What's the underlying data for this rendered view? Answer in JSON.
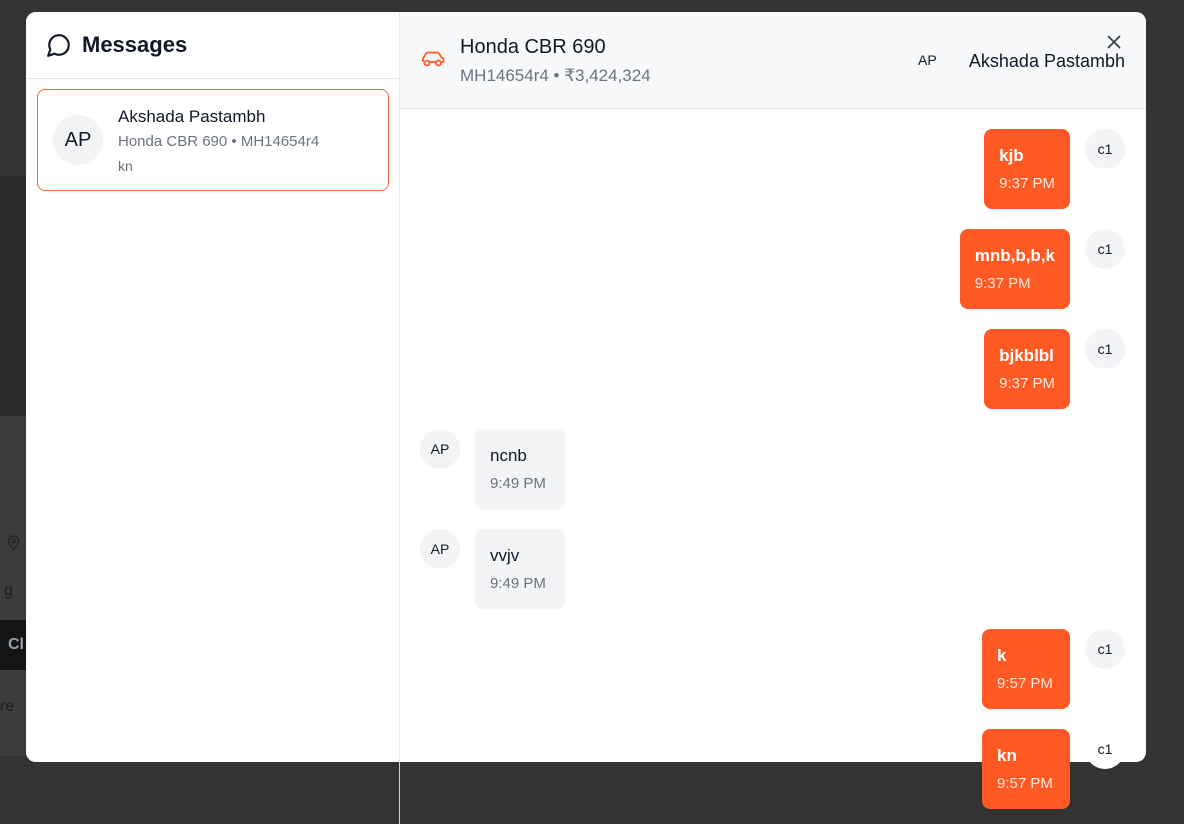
{
  "background": {
    "fragments": [
      "g",
      "Cl",
      "re"
    ]
  },
  "sidebar": {
    "title": "Messages",
    "conversations": [
      {
        "initials": "AP",
        "name": "Akshada Pastambh",
        "subtitle": "Honda CBR 690 • MH14654r4",
        "last_message": "kn"
      }
    ]
  },
  "chat": {
    "header": {
      "vehicle_name": "Honda CBR 690",
      "vehicle_meta": "MH14654r4 • ₹3,424,324",
      "avatar_initials": "AP",
      "user_name": "Akshada Pastambh"
    },
    "messages": [
      {
        "direction": "out",
        "text": "kjb",
        "time": "9:37 PM",
        "avatar": "c1"
      },
      {
        "direction": "out",
        "text": "mnb,b,b,k",
        "time": "9:37 PM",
        "avatar": "c1"
      },
      {
        "direction": "out",
        "text": "bjkblbl",
        "time": "9:37 PM",
        "avatar": "c1"
      },
      {
        "direction": "in",
        "text": "ncnb",
        "time": "9:49 PM",
        "avatar": "AP"
      },
      {
        "direction": "in",
        "text": "vvjv",
        "time": "9:49 PM",
        "avatar": "AP"
      },
      {
        "direction": "out",
        "text": "k",
        "time": "9:57 PM",
        "avatar": "c1"
      },
      {
        "direction": "out",
        "text": "kn",
        "time": "9:57 PM",
        "avatar": "c1"
      }
    ]
  },
  "colors": {
    "accent": "#ff5a24",
    "accent_border": "#f26b3a"
  },
  "icons": {
    "sidebar": "chat-bubble-icon",
    "header": "car-icon",
    "close": "close-icon"
  }
}
